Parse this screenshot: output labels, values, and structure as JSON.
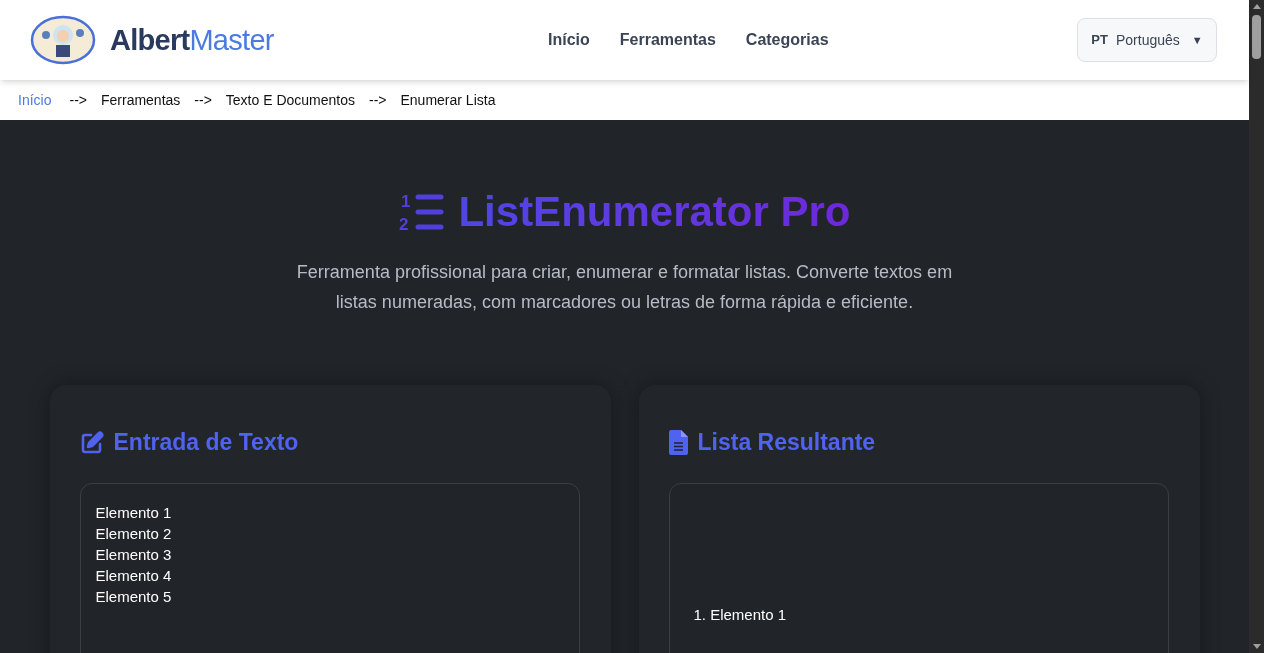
{
  "header": {
    "brand_left": "Albert",
    "brand_right": "Master",
    "nav": [
      {
        "label": "Início"
      },
      {
        "label": "Ferramentas"
      },
      {
        "label": "Categorias"
      }
    ],
    "language": {
      "code": "PT",
      "label": "Português",
      "caret": "▼"
    }
  },
  "breadcrumb": [
    {
      "label": "Início",
      "link": true
    },
    {
      "label": "-->",
      "link": false
    },
    {
      "label": "Ferramentas",
      "link": false
    },
    {
      "label": "-->",
      "link": false
    },
    {
      "label": "Texto E Documentos",
      "link": false
    },
    {
      "label": "-->",
      "link": false
    },
    {
      "label": "Enumerar Lista",
      "link": false
    }
  ],
  "hero": {
    "icon_digits": [
      "1",
      "2"
    ],
    "title": "ListEnumerator Pro",
    "description": "Ferramenta profissional para criar, enumerar e formatar listas. Converte textos em listas numeradas, com marcadores ou letras de forma rápida e eficiente."
  },
  "panels": [
    {
      "kind": "input",
      "title": "Entrada de Texto",
      "lines": [
        "Elemento 1",
        "Elemento 2",
        "Elemento 3",
        "Elemento 4",
        "Elemento 5"
      ]
    },
    {
      "kind": "output",
      "title": "Lista Resultante",
      "lines": [
        "1. Elemento 1"
      ]
    }
  ]
}
